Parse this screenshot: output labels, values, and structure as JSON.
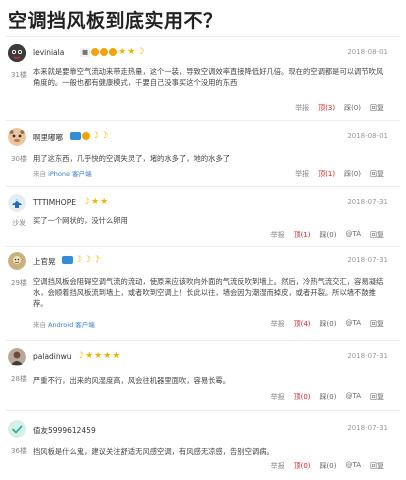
{
  "page": {
    "title": "空调挡风板到底实用不？"
  },
  "comments": [
    {
      "floor": "31楼",
      "user": "leviniala",
      "date": "2018-08-01",
      "text": "本来就是要靠空气流动来带走热量，这个一装，导致空调效率直接降低好几倍。现在的空调都是可以调节吹风角度的。一般也都有健康模式，千要自己没事买这个没用的东西",
      "from": "",
      "from_link": "",
      "actions": {
        "report": "举报",
        "up": "顶(3)",
        "down": "踩(0)",
        "reply": "回复"
      },
      "badges": [
        "circle",
        "circle",
        "circle",
        "star",
        "star",
        "moon"
      ]
    },
    {
      "floor": "30楼",
      "user": "啊里嘟嘟",
      "date": "2018-08-01",
      "text": "用了这东西，几乎快的空调失灵了，堵的水多了，地的水多了",
      "from": "来自",
      "from_link": "iPhone 客户端",
      "actions": {
        "report": "举报",
        "up": "顶(1)",
        "down": "踩(0)",
        "reply": "回复"
      },
      "badges": [
        "bird",
        "circle",
        "moon",
        "moon"
      ]
    },
    {
      "floor": "沙发",
      "user": "TTTIMHOPE",
      "date": "2018-07-31",
      "text": "买了一个网状的，没什么卵用",
      "from": "",
      "from_link": "",
      "actions": {
        "report": "举报",
        "up": "顶(1)",
        "down": "踩(0)",
        "at": "@TA",
        "reply": "回复"
      },
      "badges": [
        "moon",
        "star",
        "star"
      ]
    },
    {
      "floor": "29楼",
      "user": "上官晃",
      "date": "2018-07-31",
      "text": "空调挡风板会阻碍空调气流的流动，使原来应该吹向外面的气流反吹到墙上。然后，冷热气流交汇，容易凝结水，会顺着挡风板流到墙上，或者吹到空调上！长此以往，墙会因为潮湿而掉皮，或者开裂。所以墙不鼓推荐。",
      "from": "来自",
      "from_link": "Android 客户端",
      "actions": {
        "report": "举报",
        "up": "顶(4)",
        "down": "踩(0)",
        "at": "@TA",
        "reply": "回复"
      },
      "badges": [
        "bird",
        "moon",
        "moon",
        "moon"
      ]
    },
    {
      "floor": "28楼",
      "user": "paladinwu",
      "date": "2018-07-31",
      "text": "严重不行，出来的风湿度高，风会往机器里面吹，容易长霉。",
      "from": "",
      "from_link": "",
      "actions": {
        "report": "举报",
        "up": "顶(0)",
        "down": "踩(0)",
        "at": "@TA",
        "reply": "回复"
      },
      "badges": [
        "moon",
        "star",
        "star",
        "star",
        "star"
      ]
    },
    {
      "floor": "36楼",
      "user": "值友5999612459",
      "date": "2018-07-31",
      "text": "挡风板是什么鬼，建议关注舒适无风感空调，有风感无凉感，告别空调病。",
      "from": "",
      "from_link": "",
      "actions": {
        "report": "举报",
        "up": "顶(0)",
        "down": "踩(0)",
        "at": "@TA",
        "reply": "回复"
      },
      "badges": []
    }
  ]
}
